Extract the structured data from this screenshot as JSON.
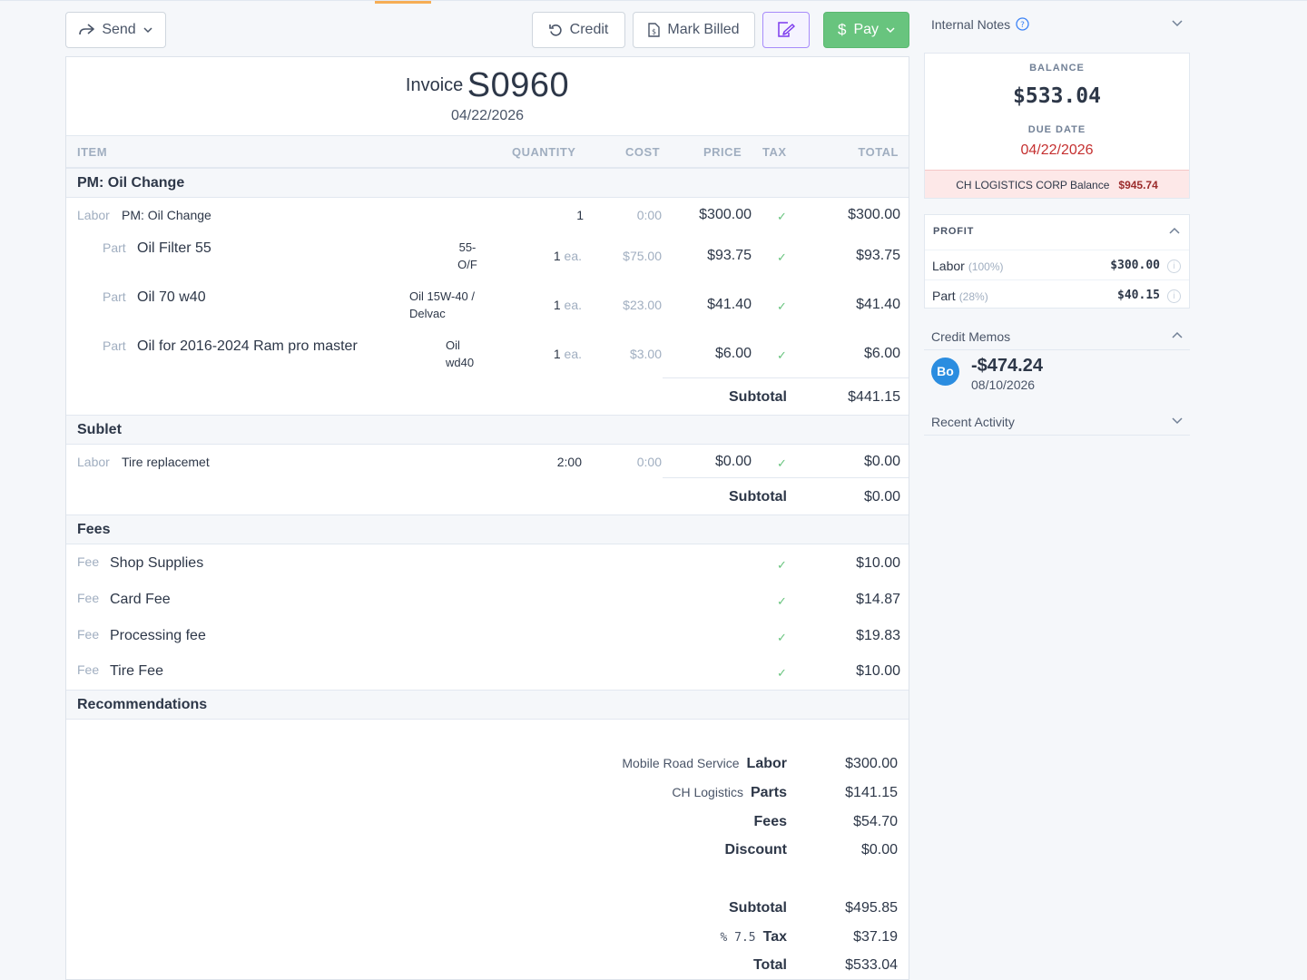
{
  "toolbar": {
    "send_label": "Send",
    "credit_label": "Credit",
    "mark_billed_label": "Mark Billed",
    "pay_label": "Pay"
  },
  "invoice": {
    "label": "Invoice",
    "number": "S0960",
    "date": "04/22/2026",
    "columns": {
      "item": "ITEM",
      "quantity": "QUANTITY",
      "cost": "COST",
      "price": "PRICE",
      "tax": "TAX",
      "total": "TOTAL"
    },
    "sections": [
      {
        "title": "PM: Oil Change",
        "lines": [
          {
            "type": "Labor",
            "desc": "PM: Oil Change",
            "code": "",
            "qty": "1",
            "unit": "",
            "cost": "0:00",
            "price": "$300.00",
            "total": "$300.00"
          },
          {
            "type": "Part",
            "desc": "Oil Filter 55",
            "code": "55-\nO/F",
            "qty": "1",
            "unit": "ea.",
            "cost": "$75.00",
            "price": "$93.75",
            "total": "$93.75"
          },
          {
            "type": "Part",
            "desc": "Oil 70 w40",
            "code": "Oil 15W-40 /\nDelvac",
            "qty": "1",
            "unit": "ea.",
            "cost": "$23.00",
            "price": "$41.40",
            "total": "$41.40"
          },
          {
            "type": "Part",
            "desc": "Oil for 2016-2024 Ram pro master",
            "code": "Oil\nwd40",
            "qty": "1",
            "unit": "ea.",
            "cost": "$3.00",
            "price": "$6.00",
            "total": "$6.00"
          }
        ],
        "subtotal_label": "Subtotal",
        "subtotal": "$441.15"
      },
      {
        "title": "Sublet",
        "lines": [
          {
            "type": "Labor",
            "desc": "Tire replacemet",
            "qty": "2:00",
            "cost": "0:00",
            "price": "$0.00",
            "total": "$0.00"
          }
        ],
        "subtotal_label": "Subtotal",
        "subtotal": "$0.00"
      },
      {
        "title": "Fees",
        "lines": [
          {
            "type": "Fee",
            "desc": "Shop Supplies",
            "total": "$10.00"
          },
          {
            "type": "Fee",
            "desc": "Card Fee",
            "total": "$14.87"
          },
          {
            "type": "Fee",
            "desc": "Processing fee",
            "total": "$19.83"
          },
          {
            "type": "Fee",
            "desc": "Tire Fee",
            "total": "$10.00"
          }
        ]
      },
      {
        "title": "Recommendations"
      }
    ],
    "summary": {
      "labor_prefix": "Mobile Road Service",
      "labor_label": "Labor",
      "labor": "$300.00",
      "parts_prefix": "CH Logistics",
      "parts_label": "Parts",
      "parts": "$141.15",
      "fees_label": "Fees",
      "fees": "$54.70",
      "discount_label": "Discount",
      "discount": "$0.00",
      "subtotal_label": "Subtotal",
      "subtotal": "$495.85",
      "tax_prefix": "% 7.5",
      "tax_label": "Tax",
      "tax": "$37.19",
      "total_label": "Total",
      "total": "$533.04"
    }
  },
  "sidebar": {
    "internal_notes_label": "Internal Notes",
    "balance_label": "BALANCE",
    "balance": "$533.04",
    "due_date_label": "DUE DATE",
    "due_date": "04/22/2026",
    "customer_balance_label": "CH LOGISTICS CORP Balance",
    "customer_balance": "$945.74",
    "profit": {
      "title": "PROFIT",
      "rows": [
        {
          "label": "Labor",
          "pct": "(100%)",
          "value": "$300.00"
        },
        {
          "label": "Part",
          "pct": "(28%)",
          "value": "$40.15"
        }
      ]
    },
    "credit_memos_label": "Credit Memos",
    "memo": {
      "avatar": "Bo",
      "amount": "-$474.24",
      "date": "08/10/2026"
    },
    "recent_activity_label": "Recent Activity"
  },
  "colors": {
    "pay_green": "#68c47e",
    "due_red": "#c53030",
    "accent_orange": "#f6ad55",
    "avatar_blue": "#2b8de0",
    "edit_purple": "#a78bfa"
  },
  "icons": {
    "send": "share-arrow-icon",
    "credit": "undo-icon",
    "mark_billed": "document-dollar-icon",
    "edit": "edit-signature-icon",
    "pay": "dollar-icon",
    "info": "question-circle-icon"
  }
}
